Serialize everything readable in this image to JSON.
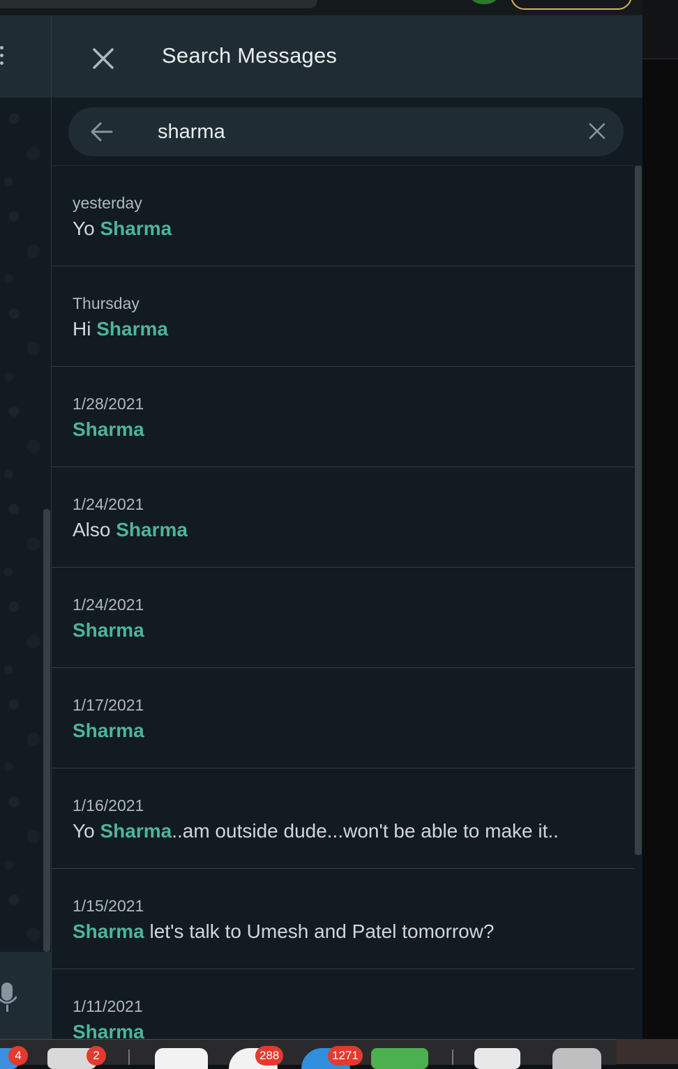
{
  "search_panel": {
    "title": "Search Messages",
    "query": "sharma",
    "results": [
      {
        "date": "yesterday",
        "before": "Yo ",
        "match": "Sharma",
        "after": ""
      },
      {
        "date": "Thursday",
        "before": "Hi ",
        "match": "Sharma",
        "after": ""
      },
      {
        "date": "1/28/2021",
        "before": "",
        "match": "Sharma",
        "after": ""
      },
      {
        "date": "1/24/2021",
        "before": "Also ",
        "match": "Sharma",
        "after": ""
      },
      {
        "date": "1/24/2021",
        "before": "",
        "match": "Sharma",
        "after": ""
      },
      {
        "date": "1/17/2021",
        "before": "",
        "match": "Sharma",
        "after": ""
      },
      {
        "date": "1/16/2021",
        "before": "Yo ",
        "match": "Sharma",
        "after": "..am outside dude...won't be able to make it.."
      },
      {
        "date": "1/15/2021",
        "before": "",
        "match": "Sharma",
        "after": " let's talk to Umesh and Patel tomorrow?"
      },
      {
        "date": "1/11/2021",
        "before": "",
        "match": "Sharma",
        "after": ""
      }
    ]
  },
  "dock": {
    "badges": [
      "4",
      "2",
      "288",
      "1271"
    ]
  },
  "colors": {
    "highlight": "#4cb59a",
    "panel_bg": "#111b21",
    "header_bg": "#202c33",
    "badge": "#e43a2f"
  }
}
